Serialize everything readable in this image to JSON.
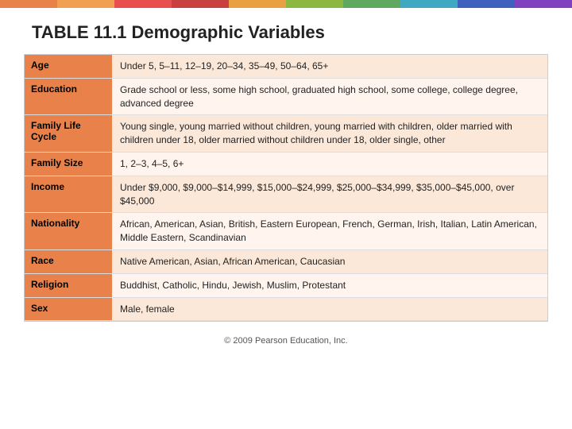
{
  "topBar": {
    "segments": [
      {
        "color": "#e8824a"
      },
      {
        "color": "#f0a050"
      },
      {
        "color": "#e85050"
      },
      {
        "color": "#c84040"
      },
      {
        "color": "#e8a040"
      },
      {
        "color": "#8ab840"
      },
      {
        "color": "#60a860"
      },
      {
        "color": "#40a8c0"
      },
      {
        "color": "#4060c0"
      },
      {
        "color": "#8040c0"
      }
    ]
  },
  "title": "TABLE 11.1 Demographic Variables",
  "tableRows": [
    {
      "label": "Age",
      "value": "Under 5, 5–11, 12–19, 20–34, 35–49, 50–64, 65+"
    },
    {
      "label": "Education",
      "value": "Grade school or less, some high school, graduated high school, some college, college degree, advanced degree"
    },
    {
      "label": "Family Life Cycle",
      "value": "Young single, young married without children, young married with children, older married with children under 18, older married without children under 18, older single, other"
    },
    {
      "label": "Family Size",
      "value": "1, 2–3, 4–5, 6+"
    },
    {
      "label": "Income",
      "value": "Under $9,000, $9,000–$14,999, $15,000–$24,999, $25,000–$34,999, $35,000–$45,000, over $45,000"
    },
    {
      "label": "Nationality",
      "value": "African, American, Asian, British, Eastern European, French, German, Irish, Italian, Latin American, Middle Eastern, Scandinavian"
    },
    {
      "label": "Race",
      "value": "Native American, Asian, African American, Caucasian"
    },
    {
      "label": "Religion",
      "value": "Buddhist, Catholic, Hindu, Jewish, Muslim, Protestant"
    },
    {
      "label": "Sex",
      "value": "Male, female"
    }
  ],
  "footer": "© 2009 Pearson Education, Inc."
}
